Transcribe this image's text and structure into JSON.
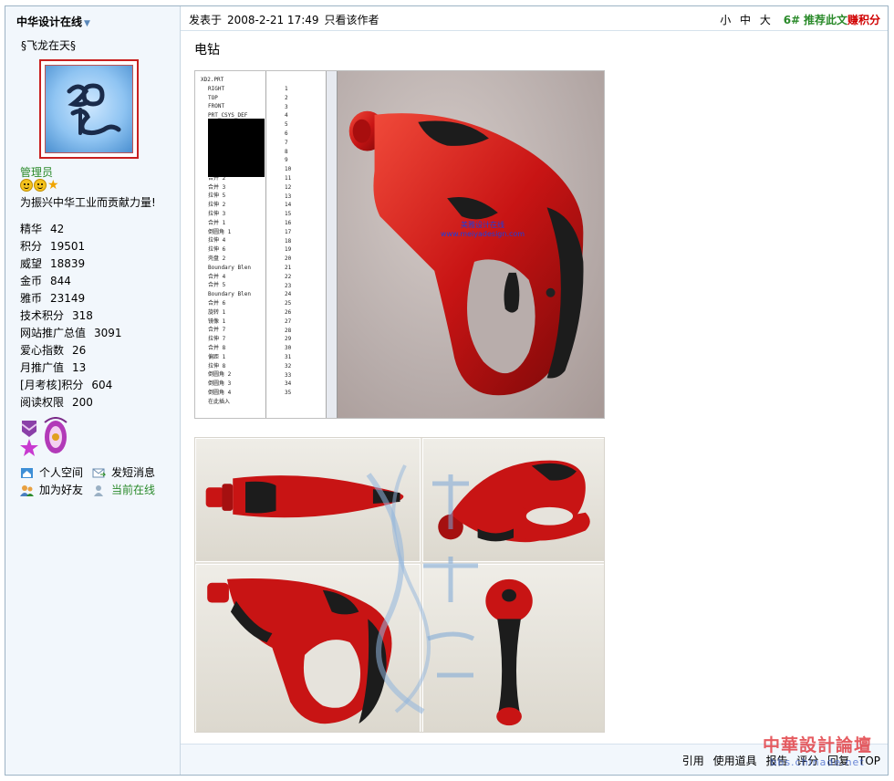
{
  "sidebar": {
    "forum_name": "中华设计在线",
    "username": "§飞龙在天§",
    "role": "管理员",
    "signature": "为振兴中华工业而贡献力量!",
    "stats": [
      {
        "label": "精华",
        "value": "42"
      },
      {
        "label": "积分",
        "value": "19501"
      },
      {
        "label": "威望",
        "value": "18839"
      },
      {
        "label": "金币",
        "value": "844"
      },
      {
        "label": "雅币",
        "value": "23149"
      },
      {
        "label": "技术积分",
        "value": "318"
      },
      {
        "label": "网站推广总值",
        "value": "3091"
      },
      {
        "label": "爱心指数",
        "value": "26"
      },
      {
        "label": "月推广值",
        "value": "13"
      },
      {
        "label": "[月考核]积分",
        "value": "604"
      },
      {
        "label": "阅读权限",
        "value": "200"
      }
    ],
    "actions": {
      "space": "个人空间",
      "message": "发短消息",
      "add_friend": "加为好友",
      "online": "当前在线"
    }
  },
  "post": {
    "posted_label": "发表于",
    "posted_time": "2008-2-21 17:49",
    "only_author": "只看该作者",
    "font_small": "小",
    "font_medium": "中",
    "font_large": "大",
    "floor": "6#",
    "recommend": "推荐此文",
    "earn": "赚积分",
    "title": "电钻"
  },
  "cad": {
    "tree_items": [
      "XD2.PRT",
      "RIGHT",
      "TOP",
      "FRONT",
      "PRT_CSYS_DEF",
      "",
      "",
      "",
      "",
      "",
      "",
      "合并 2",
      "合并 3",
      "拉伸 5",
      "拉伸 2",
      "拉伸 3",
      "合并 1",
      "倒圆角 1",
      "拉伸 4",
      "拉伸 6",
      "壳盘 2",
      "Boundary Blen",
      "合并 4",
      "合并 5",
      "Boundary Blen",
      "合并 6",
      "旋转 1",
      "镜像 1",
      "合并 7",
      "拉伸 7",
      "合并 8",
      "偏距 1",
      "拉伸 8",
      "倒圆角 2",
      "倒圆角 3",
      "倒圆角 4",
      "在此插入"
    ],
    "row_numbers": [
      "1",
      "2",
      "3",
      "4",
      "5",
      "6",
      "7",
      "8",
      "9",
      "10",
      "11",
      "12",
      "13",
      "14",
      "15",
      "16",
      "17",
      "18",
      "19",
      "20",
      "21",
      "22",
      "23",
      "24",
      "25",
      "26",
      "27",
      "28",
      "29",
      "30",
      "31",
      "32",
      "33",
      "34",
      "35"
    ],
    "watermark_line1": "美雅设计在线",
    "watermark_line2": "www.meiyadesign.com"
  },
  "footer": {
    "quote": "引用",
    "use_tool": "使用道具",
    "report": "报告",
    "rate": "评分",
    "reply": "回复",
    "top": "TOP"
  },
  "brand": {
    "logo_big": "中華設計論壇",
    "logo_small": "bbs.chinade.net"
  },
  "colors": {
    "accent_red": "#d00000",
    "accent_green": "#2a8a2a",
    "product_red": "#c81414",
    "product_black": "#1c1c1c"
  }
}
